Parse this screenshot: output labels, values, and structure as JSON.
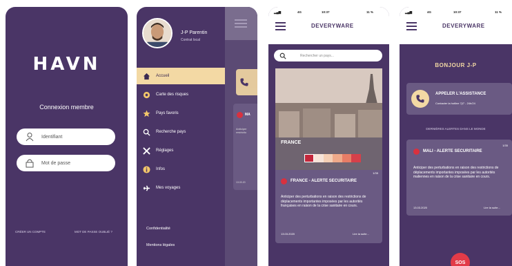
{
  "login": {
    "logo": "HAVN",
    "title": "Connexion membre",
    "id_placeholder": "Identifiant",
    "pwd_placeholder": "Mot de passe",
    "create_account": "CRÉER UN COMPTE",
    "forgot_password": "MOT DE PASSE OUBLIÉ ?"
  },
  "menu": {
    "user_name": "J-P Parentin",
    "user_contract": "Contrat local",
    "items": [
      {
        "label": "Accueil",
        "icon": "home-icon"
      },
      {
        "label": "Carte des risques",
        "icon": "map-icon"
      },
      {
        "label": "Pays favoris",
        "icon": "star-icon"
      },
      {
        "label": "Recherche pays",
        "icon": "search-icon"
      },
      {
        "label": "Réglages",
        "icon": "tools-icon"
      },
      {
        "label": "Infos",
        "icon": "info-icon"
      },
      {
        "label": "Mes voyages",
        "icon": "plane-icon"
      }
    ],
    "privacy": "Confidentialité",
    "legal": "Mentions légales",
    "peek_card_title": "MA",
    "peek_card_text": "Anticiper restrictio",
    "peek_date": "13.03.20"
  },
  "feed": {
    "time": "10:37",
    "network": "4G",
    "battery": "11 %",
    "brand": "DEVERYWARE",
    "search_placeholder": "Rechercher un pays...",
    "country": "FRANCE",
    "pager": "1/35",
    "alert_title": "FRANCE - ALERTE SECURITAIRE",
    "alert_body": "Anticiper des perturbations en raison des restrictions de déplacements importantes imposées par les autorités françaises en raison de la crise sanitaire en cours.",
    "date": "13.03.2020",
    "more": "Lire la suite..."
  },
  "home": {
    "time": "10:37",
    "network": "4G",
    "battery": "11 %",
    "brand": "DEVERYWARE",
    "greeting": "BONJOUR J-P",
    "call_title": "APPELER L'ASSISTANCE",
    "call_sub": "Contacter la hotline 7j/7 - 24h/24",
    "section": "DERNIÈRES ALERTES DANS LE MONDE",
    "pager": "1/35",
    "alert_title": "MALI - ALERTE SECURITAIRE",
    "alert_body": "Anticiper des perturbations en raison des restrictions de déplacements importantes imposées par les autorités maliennes en raison de la crise sanitaire en cours.",
    "date": "13.03.2020",
    "more": "Lire la suite...",
    "sos": "SOS"
  },
  "colors": {
    "purple": "#4a3566",
    "card": "#6a5a83",
    "accent": "#f3d9a4",
    "alert_red": "#d8313f",
    "sos_red": "#e23b48"
  }
}
